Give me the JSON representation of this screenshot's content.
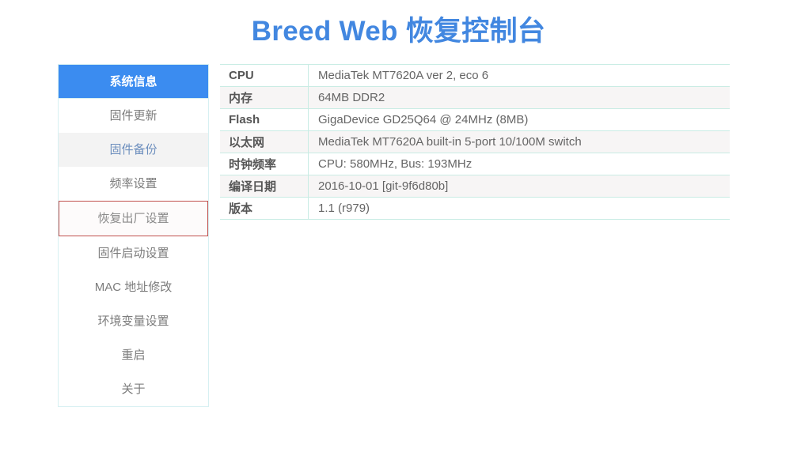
{
  "header": {
    "title": "Breed Web 恢复控制台",
    "title_color": "#4287e0"
  },
  "sidebar": {
    "border_color": "#d7f0f2",
    "active_bg": "#3b8cf0",
    "hover_bg": "#f3f3f3",
    "focus_border": "#c0504d",
    "items": [
      {
        "label": "系统信息",
        "state": "active"
      },
      {
        "label": "固件更新",
        "state": "normal"
      },
      {
        "label": "固件备份",
        "state": "hovered"
      },
      {
        "label": "频率设置",
        "state": "normal"
      },
      {
        "label": "恢复出厂设置",
        "state": "focused"
      },
      {
        "label": "固件启动设置",
        "state": "normal"
      },
      {
        "label": "MAC 地址修改",
        "state": "normal"
      },
      {
        "label": "环境变量设置",
        "state": "normal"
      },
      {
        "label": "重启",
        "state": "normal"
      },
      {
        "label": "关于",
        "state": "normal"
      }
    ]
  },
  "main": {
    "table": {
      "border_color": "#c9ece4",
      "alt_row_bg": "#f7f5f5",
      "rows": [
        {
          "key": "CPU",
          "value": "MediaTek MT7620A ver 2, eco 6"
        },
        {
          "key": "内存",
          "value": "64MB DDR2"
        },
        {
          "key": "Flash",
          "value": "GigaDevice GD25Q64 @ 24MHz (8MB)"
        },
        {
          "key": "以太网",
          "value": "MediaTek MT7620A built-in 5-port 10/100M switch"
        },
        {
          "key": "时钟频率",
          "value": "CPU: 580MHz, Bus: 193MHz"
        },
        {
          "key": "编译日期",
          "value": "2016-10-01 [git-9f6d80b]"
        },
        {
          "key": "版本",
          "value": "1.1 (r979)"
        }
      ]
    }
  }
}
